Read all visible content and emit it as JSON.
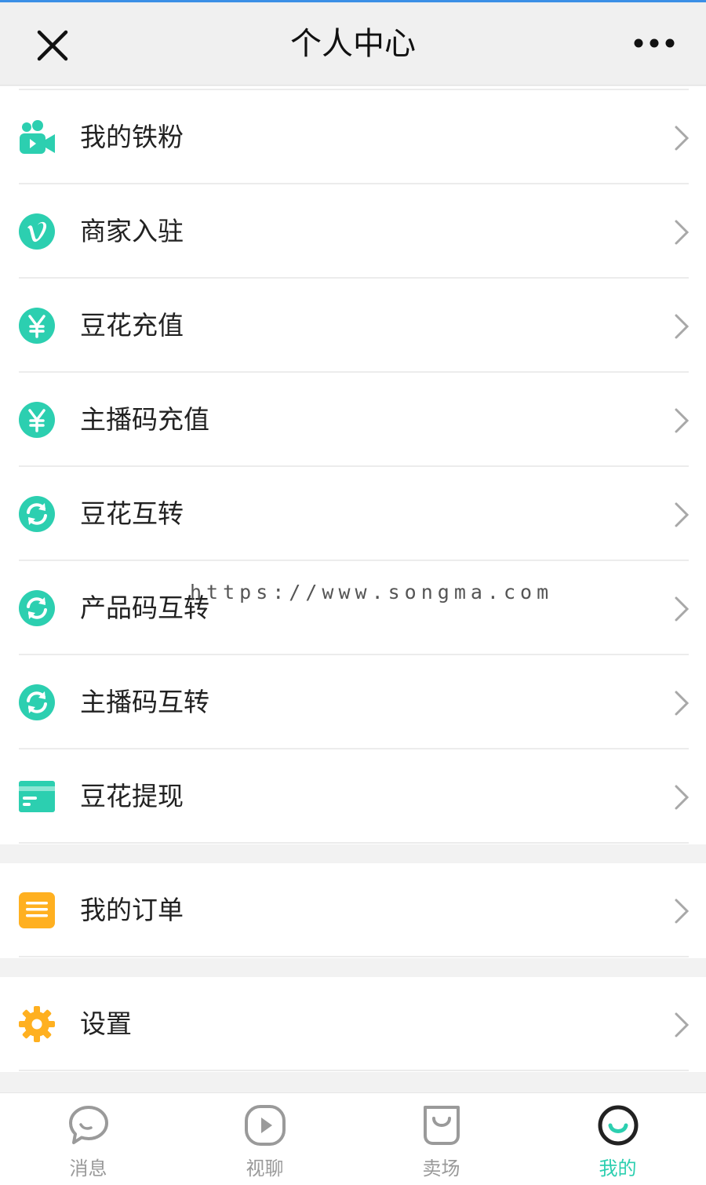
{
  "header": {
    "title": "个人中心",
    "close_icon": "close-icon",
    "more_icon": "more-dots-icon"
  },
  "menu_group_1": [
    {
      "id": "tiefen",
      "label": "我的铁粉",
      "icon": "fans-camera-icon"
    },
    {
      "id": "merchant",
      "label": "商家入驻",
      "icon": "vimeo-v-icon"
    },
    {
      "id": "douhua-recharge",
      "label": "豆花充值",
      "icon": "yen-icon"
    },
    {
      "id": "anchor-code-recharge",
      "label": "主播码充值",
      "icon": "yen-icon"
    },
    {
      "id": "douhua-transfer",
      "label": "豆花互转",
      "icon": "refresh-icon"
    },
    {
      "id": "product-code-transfer",
      "label": "产品码互转",
      "icon": "refresh-icon"
    },
    {
      "id": "anchor-code-transfer",
      "label": "主播码互转",
      "icon": "refresh-icon"
    },
    {
      "id": "douhua-withdraw",
      "label": "豆花提现",
      "icon": "card-icon"
    }
  ],
  "menu_group_2": [
    {
      "id": "orders",
      "label": "我的订单",
      "icon": "list-icon"
    }
  ],
  "menu_group_3": [
    {
      "id": "settings",
      "label": "设置",
      "icon": "gear-icon"
    }
  ],
  "watermark": "https://www.songma.com",
  "tabbar": [
    {
      "label": "消息",
      "icon": "chat-bubble-icon",
      "active": false
    },
    {
      "label": "视聊",
      "icon": "play-circle-icon",
      "active": false
    },
    {
      "label": "卖场",
      "icon": "shopping-bag-icon",
      "active": false
    },
    {
      "label": "我的",
      "icon": "smile-circle-icon",
      "active": true
    }
  ],
  "colors": {
    "accent_teal": "#2ccfb0",
    "accent_orange": "#ffb020",
    "tab_inactive": "#9a9a9a",
    "background": "#f2f2f2"
  }
}
